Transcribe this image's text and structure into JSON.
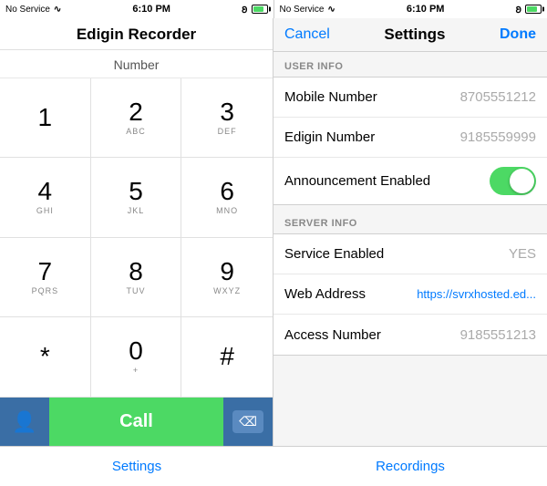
{
  "status": {
    "left": {
      "signal": "No Service",
      "wifi": "wifi",
      "time": "6:10 PM",
      "bluetooth": "bt",
      "battery": "green"
    },
    "right": {
      "signal": "No Service",
      "wifi": "wifi",
      "time": "6:10 PM",
      "bluetooth": "bt",
      "battery": "green"
    }
  },
  "dialer": {
    "title": "Edigin Recorder",
    "number_label": "Number",
    "keys": [
      {
        "digit": "1",
        "letters": ""
      },
      {
        "digit": "2",
        "letters": "ABC"
      },
      {
        "digit": "3",
        "letters": "DEF"
      },
      {
        "digit": "4",
        "letters": "GHI"
      },
      {
        "digit": "5",
        "letters": "JKL"
      },
      {
        "digit": "6",
        "letters": "MNO"
      },
      {
        "digit": "7",
        "letters": "PQRS"
      },
      {
        "digit": "8",
        "letters": "TUV"
      },
      {
        "digit": "9",
        "letters": "WXYZ"
      },
      {
        "digit": "*",
        "letters": ""
      },
      {
        "digit": "0",
        "letters": "+"
      },
      {
        "digit": "#",
        "letters": ""
      }
    ],
    "call_label": "Call",
    "delete_label": "⌫"
  },
  "bottom_nav": {
    "settings": "Settings",
    "recordings": "Recordings"
  },
  "settings": {
    "cancel_label": "Cancel",
    "title": "Settings",
    "done_label": "Done",
    "user_info_header": "USER INFO",
    "server_info_header": "SERVER INFO",
    "rows": [
      {
        "label": "Mobile Number",
        "value": "8705551212",
        "type": "text"
      },
      {
        "label": "Edigin Number",
        "value": "9185559999",
        "type": "text"
      },
      {
        "label": "Announcement Enabled",
        "value": "",
        "type": "toggle"
      },
      {
        "label": "Service Enabled",
        "value": "YES",
        "type": "text"
      },
      {
        "label": "Web Address",
        "value": "https://svrxhosted.ed...",
        "type": "link"
      },
      {
        "label": "Access Number",
        "value": "9185551213",
        "type": "text"
      }
    ]
  }
}
